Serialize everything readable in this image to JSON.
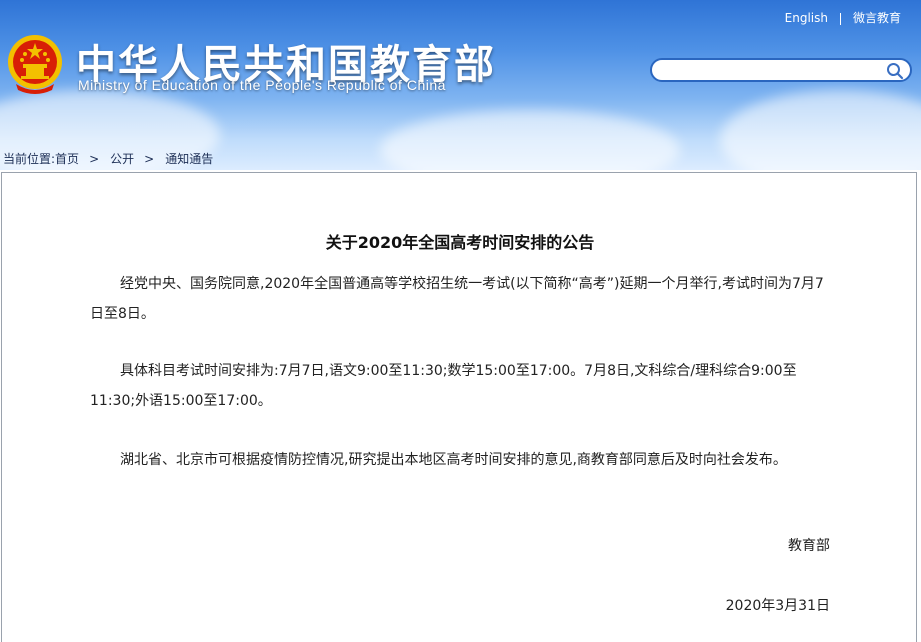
{
  "header": {
    "site_title": "中华人民共和国教育部",
    "site_subtitle": "Ministry of Education of the People's Republic of China",
    "links": {
      "english": "English",
      "weibo": "微言教育"
    },
    "search": {
      "value": "",
      "placeholder": ""
    },
    "icons": {
      "emblem": "national-emblem",
      "search": "search-icon"
    }
  },
  "breadcrumb": {
    "prefix": "当前位置:",
    "items": [
      "首页",
      "公开",
      "通知通告"
    ],
    "separator": ">"
  },
  "article": {
    "title": "关于2020年全国高考时间安排的公告",
    "paragraphs": [
      "经党中央、国务院同意,2020年全国普通高等学校招生统一考试(以下简称“高考”)延期一个月举行,考试时间为7月7日至8日。",
      "具体科目考试时间安排为:7月7日,语文9:00至11:30;数学15:00至17:00。7月8日,文科综合/理科综合9:00至11:30;外语15:00至17:00。",
      "湖北省、北京市可根据疫情防控情况,研究提出本地区高考时间安排的意见,商教育部同意后及时向社会发布。"
    ],
    "signature": "教育部",
    "date": "2020年3月31日"
  },
  "colors": {
    "header_top": "#2f74d6",
    "header_bottom": "#dcecff",
    "search_border": "#2a66bf",
    "emblem_red": "#d81e06",
    "emblem_gold": "#f3c000",
    "content_border": "#9aa2ad"
  }
}
